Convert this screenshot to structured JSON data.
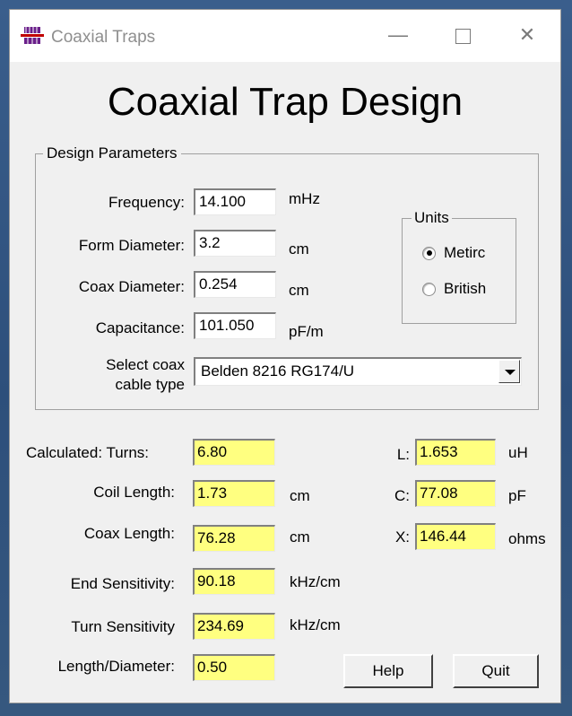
{
  "window": {
    "title": "Coaxial Traps",
    "controls": {
      "minimize": "—",
      "close": "✕"
    }
  },
  "heading": "Coaxial Trap Design",
  "design_parameters": {
    "legend": "Design Parameters",
    "frequency": {
      "label": "Frequency:",
      "value": "14.100",
      "unit": "mHz"
    },
    "form_diameter": {
      "label": "Form Diameter:",
      "value": "3.2",
      "unit": "cm"
    },
    "coax_diameter": {
      "label": "Coax Diameter:",
      "value": "0.254",
      "unit": "cm"
    },
    "capacitance": {
      "label": "Capacitance:",
      "value": "101.050",
      "unit": "pF/m"
    },
    "cable_type": {
      "label_line1": "Select coax",
      "label_line2": "cable type",
      "selected": "Belden 8216 RG174/U"
    },
    "units": {
      "legend": "Units",
      "options": [
        "Metirc",
        "British"
      ],
      "selected": "Metirc"
    }
  },
  "results": {
    "turns": {
      "label": "Calculated:  Turns:",
      "value": "6.80"
    },
    "coil_length": {
      "label": "Coil Length:",
      "value": "1.73",
      "unit": "cm"
    },
    "coax_length": {
      "label": "Coax Length:",
      "value": "76.28",
      "unit": "cm"
    },
    "end_sensitivity": {
      "label": "End Sensitivity:",
      "value": "90.18",
      "unit": "kHz/cm"
    },
    "turn_sensitivity": {
      "label": "Turn Sensitivity",
      "value": "234.69",
      "unit": "kHz/cm"
    },
    "length_diameter": {
      "label": "Length/Diameter:",
      "value": "0.50"
    },
    "inductance": {
      "label": "L:",
      "value": "1.653",
      "unit": "uH"
    },
    "capacitance": {
      "label": "C:",
      "value": "77.08",
      "unit": "pF"
    },
    "reactance": {
      "label": "X:",
      "value": "146.44",
      "unit": "ohms"
    }
  },
  "buttons": {
    "help": "Help",
    "quit": "Quit"
  },
  "colors": {
    "output_background": "#ffff80",
    "window_background": "#f0f0f0",
    "desktop": "#2d4f7b"
  }
}
